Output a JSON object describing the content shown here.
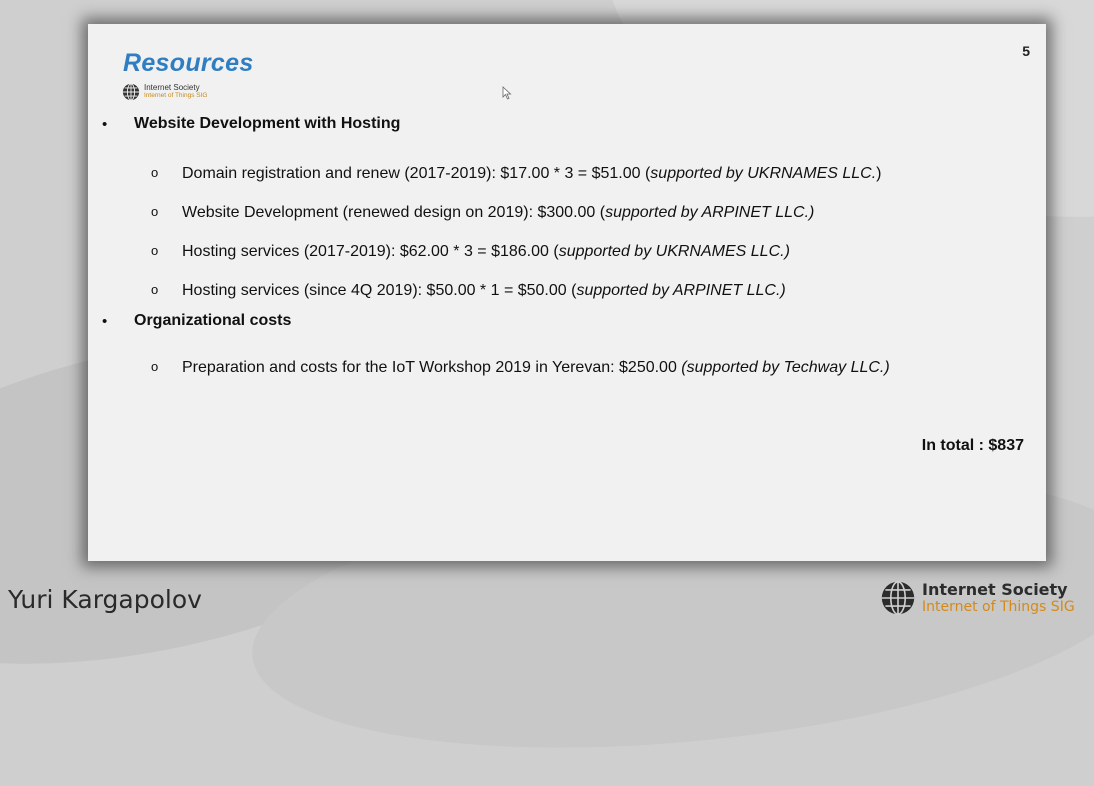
{
  "slide": {
    "title": "Resources",
    "page_number": "5",
    "logo": {
      "line1": "Internet Society",
      "line2": "Internet of Things SIG",
      "icon": "globe-icon"
    },
    "sections": [
      {
        "bullet": "•",
        "heading": "Website Development with Hosting",
        "items": [
          {
            "marker": "o",
            "text": "Domain registration and renew (2017-2019):  $17.00 * 3 = $51.00 (",
            "italic": "supported by UKRNAMES LLC.",
            "tail": ")"
          },
          {
            "marker": "o",
            "text": "Website Development (renewed design on 2019): $300.00 (",
            "italic": "supported by ARPINET LLC.)",
            "tail": ""
          },
          {
            "marker": "o",
            "text": "Hosting services (2017-2019): $62.00 * 3 = $186.00 (",
            "italic": "supported by UKRNAMES LLC.)",
            "tail": ""
          },
          {
            "marker": "o",
            "text": "Hosting services (since 4Q 2019): $50.00 * 1 = $50.00 (",
            "italic": "supported by ARPINET LLC.)",
            "tail": ""
          }
        ]
      },
      {
        "bullet": "•",
        "heading": "Organizational costs",
        "items": [
          {
            "marker": "o",
            "text": "Preparation and costs for the IoT Workshop 2019 in Yerevan: $250.00 ",
            "italic": "(supported by Techway LLC.)",
            "tail": ""
          }
        ]
      }
    ],
    "total": "In total : $837"
  },
  "footer": {
    "presenter": "Yuri Kargapolov",
    "logo": {
      "line1": "Internet Society",
      "line2": "Internet of Things SIG",
      "icon": "globe-icon"
    }
  },
  "colors": {
    "title": "#2f7ec2",
    "logo_sub": "#d48a1a",
    "slide_bg": "#f1f1f1"
  }
}
